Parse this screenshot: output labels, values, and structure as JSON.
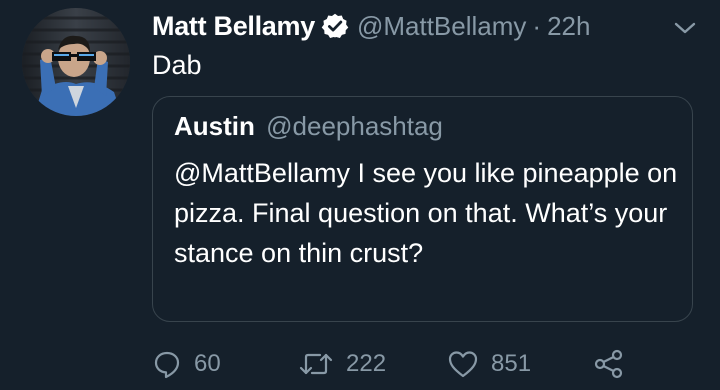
{
  "tweet": {
    "display_name": "Matt Bellamy",
    "handle": "@MattBellamy",
    "separator": "·",
    "timestamp": "22h",
    "text": "Dab",
    "verified": true
  },
  "quoted_tweet": {
    "display_name": "Austin",
    "handle": "@deephashtag",
    "text": "@MattBellamy I see you like pineapple on pizza. Final question on that. What’s your stance on thin crust?"
  },
  "actions": {
    "reply_count": "60",
    "retweet_count": "222",
    "like_count": "851"
  },
  "icons": {
    "verified": "verified-badge-icon",
    "caret": "chevron-down-icon",
    "reply": "reply-icon",
    "retweet": "retweet-icon",
    "like": "heart-icon",
    "share": "share-icon"
  },
  "colors": {
    "background": "#15202b",
    "primary_text": "#ffffff",
    "secondary_text": "#8899a6",
    "border": "#38444d"
  }
}
